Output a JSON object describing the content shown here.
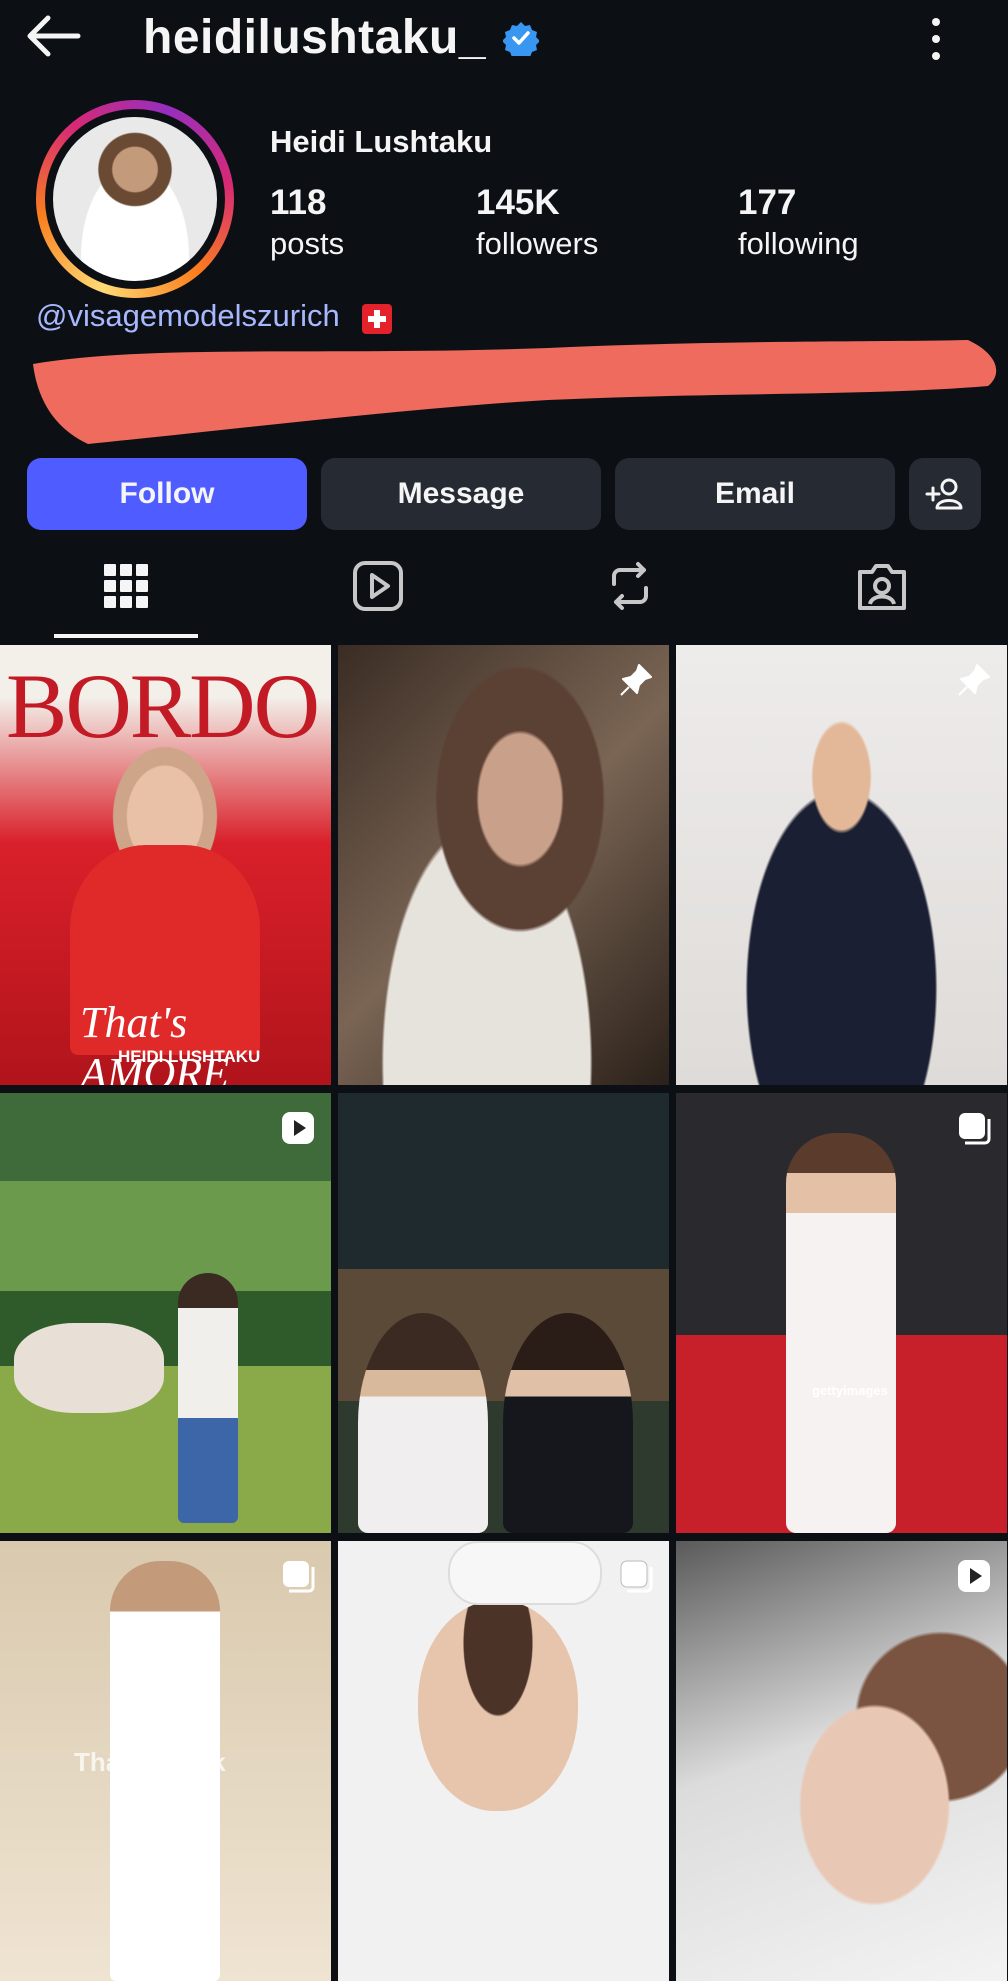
{
  "header": {
    "username": "heidilushtaku_",
    "back_icon": "arrow-left-icon",
    "verified_icon": "verified-badge-icon",
    "more_icon": "more-vertical-icon"
  },
  "profile": {
    "full_name": "Heidi Lushtaku",
    "stats": [
      {
        "value": "118",
        "label": "posts"
      },
      {
        "value": "145K",
        "label": "followers"
      },
      {
        "value": "177",
        "label": "following"
      }
    ],
    "mention": "@visagemodelszurich",
    "flag_icon": "swiss-flag-icon",
    "bio_redacted": true
  },
  "actions": {
    "follow": "Follow",
    "message": "Message",
    "email": "Email",
    "add_user_icon": "add-user-icon"
  },
  "tabs": [
    "grid-icon",
    "reels-icon",
    "reposts-icon",
    "tagged-icon"
  ],
  "posts": [
    {
      "badge": "none",
      "overlay_text": "BORDO",
      "caption": "That's AMORE",
      "sub": "HEIDI LUSHTAKU"
    },
    {
      "badge": "pin-icon"
    },
    {
      "badge": "pin-icon"
    },
    {
      "badge": "reel-icon"
    },
    {
      "badge": "none"
    },
    {
      "badge": "carousel-icon",
      "overlay_text": "gettyimages"
    },
    {
      "badge": "carousel-icon",
      "overlay_text": "ThaiCatwalk"
    },
    {
      "badge": "carousel-icon"
    },
    {
      "badge": "reel-icon"
    }
  ],
  "colors": {
    "background": "#0c1014",
    "follow": "#4f5cff",
    "button": "#262a33",
    "mention": "#a8b8ff",
    "verified": "#3897f0",
    "redaction": "#ef6b5e"
  }
}
